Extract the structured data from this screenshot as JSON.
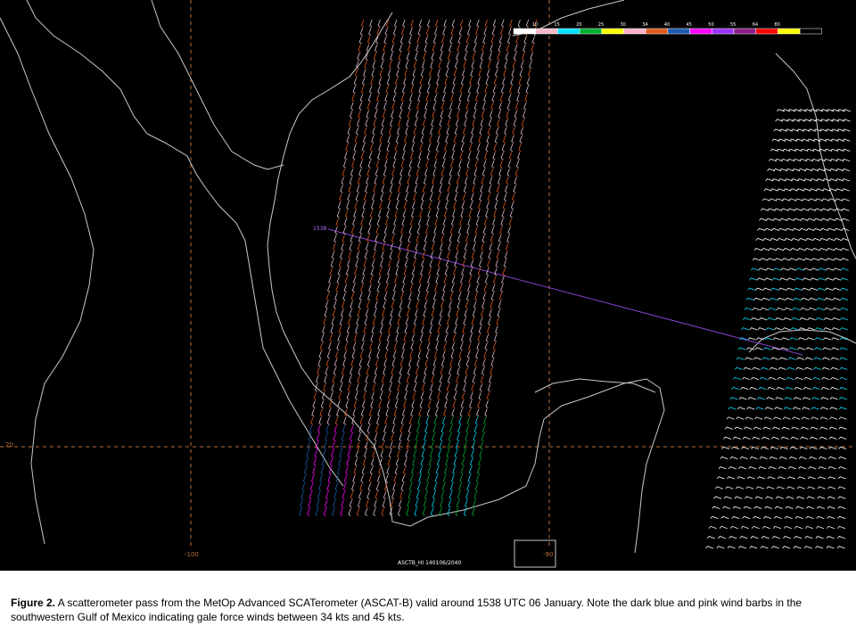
{
  "map": {
    "colors": {
      "background": "#000000",
      "coastline": "#c8c8c8",
      "grid": "#c0703a",
      "track": "#8a3fd0",
      "barb_default": "#e0c0d0",
      "barb_alt": "#e05a1c",
      "barb_light": "#ffffff"
    },
    "grid_labels": {
      "lon_100": "-100",
      "lon_90": "-90",
      "lat_20": "20"
    },
    "track_time_label": "1538",
    "footer_label": "ASCTB_HI 140106/2040"
  },
  "legend": {
    "labels": [
      "10",
      "15",
      "20",
      "25",
      "30",
      "34",
      "40",
      "45",
      "50",
      "55",
      "64",
      "80"
    ],
    "colors": [
      "#ffffff",
      "#f4b8c8",
      "#00e0ff",
      "#00b030",
      "#ffff00",
      "#ffb0c8",
      "#e05a1c",
      "#1c5ab0",
      "#ff00ff",
      "#9b30ff",
      "#8b1a8b",
      "#ff0000",
      "#ffff00",
      "#000000"
    ]
  },
  "caption": {
    "label": "Figure 2.",
    "text": " A scatterometer pass from the MetOp Advanced SCATerometer (ASCAT-B) valid around 1538 UTC 06 January. Note the dark blue and pink wind barbs in the southwestern Gulf of Mexico indicating gale force winds between 34 kts and 45 kts."
  }
}
